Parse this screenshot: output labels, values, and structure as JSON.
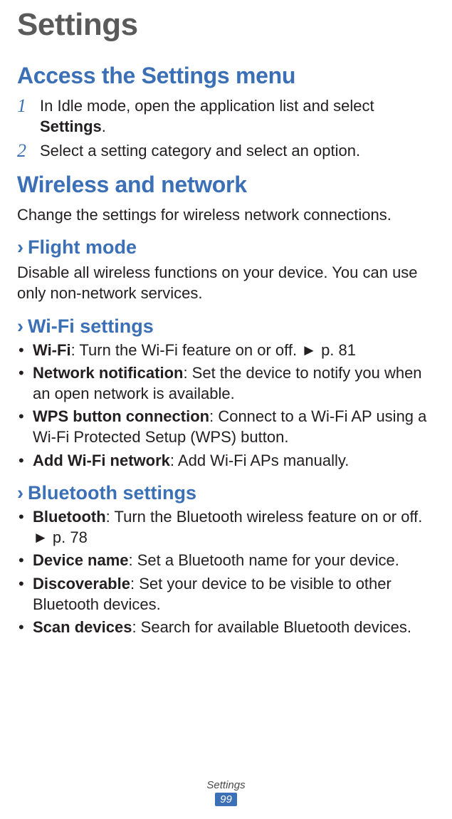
{
  "title": "Settings",
  "section_access": {
    "heading": "Access the Settings menu",
    "steps": [
      {
        "num": "1",
        "prefix": "In Idle mode, open the application list and select ",
        "bold": "Settings",
        "suffix": "."
      },
      {
        "num": "2",
        "prefix": "Select a setting category and select an option.",
        "bold": "",
        "suffix": ""
      }
    ]
  },
  "section_wireless": {
    "heading": "Wireless and network",
    "intro": "Change the settings for wireless network connections."
  },
  "flight": {
    "chev": "›",
    "heading": "Flight mode",
    "body": "Disable all wireless functions on your device. You can use only non-network services."
  },
  "wifi": {
    "chev": "›",
    "heading": "Wi-Fi settings",
    "items": [
      {
        "bold": "Wi-Fi",
        "rest": ": Turn the Wi-Fi feature on or off. ► p. 81"
      },
      {
        "bold": "Network notification",
        "rest": ": Set the device to notify you when an open network is available."
      },
      {
        "bold": "WPS button connection",
        "rest": ": Connect to a Wi-Fi AP using a Wi-Fi Protected Setup (WPS) button."
      },
      {
        "bold": "Add Wi-Fi network",
        "rest": ": Add Wi-Fi APs manually."
      }
    ]
  },
  "bt": {
    "chev": "›",
    "heading": "Bluetooth settings",
    "items": [
      {
        "bold": "Bluetooth",
        "rest": ": Turn the Bluetooth wireless feature on or off. ► p. 78"
      },
      {
        "bold": "Device name",
        "rest": ": Set a Bluetooth name for your device."
      },
      {
        "bold": "Discoverable",
        "rest": ": Set your device to be visible to other Bluetooth devices."
      },
      {
        "bold": "Scan devices",
        "rest": ": Search for available Bluetooth devices."
      }
    ]
  },
  "footer": {
    "label": "Settings",
    "page": "99"
  }
}
